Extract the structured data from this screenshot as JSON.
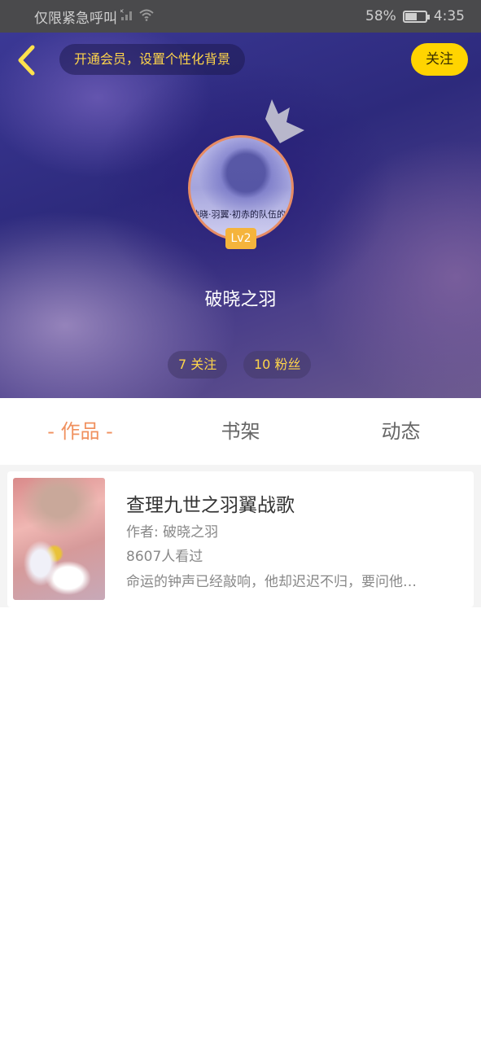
{
  "status_bar": {
    "carrier_text": "仅限紧急呼叫",
    "battery_percent": "58%",
    "battery_level": 0.58,
    "time": "4:35",
    "icons": [
      "no-signal-icon",
      "wifi-icon",
      "battery-icon"
    ]
  },
  "header": {
    "back_icon": "chevron-left-icon",
    "vip_prompt": "开通会员，设置个性化背景",
    "follow_label": "关注",
    "crown_icon": "crown-icon",
    "avatar_caption": "缺晓·羽翼·初赤的队伍的从",
    "level": "Lv2",
    "username": "破晓之羽",
    "following": "7 关注",
    "followers": "10 粉丝"
  },
  "tabs": [
    {
      "label": "- 作品 -",
      "active": true
    },
    {
      "label": "书架",
      "active": false
    },
    {
      "label": "动态",
      "active": false
    }
  ],
  "works": [
    {
      "title": "查理九世之羽翼战歌",
      "author": "作者: 破晓之羽",
      "views": "8607人看过",
      "description": "命运的钟声已经敲响，他却迟迟不归，要问他…"
    }
  ],
  "colors": {
    "accent_yellow": "#ffd400",
    "tab_active": "#f0915f",
    "level_badge": "#f5b43c",
    "avatar_border": "#e78c64"
  }
}
